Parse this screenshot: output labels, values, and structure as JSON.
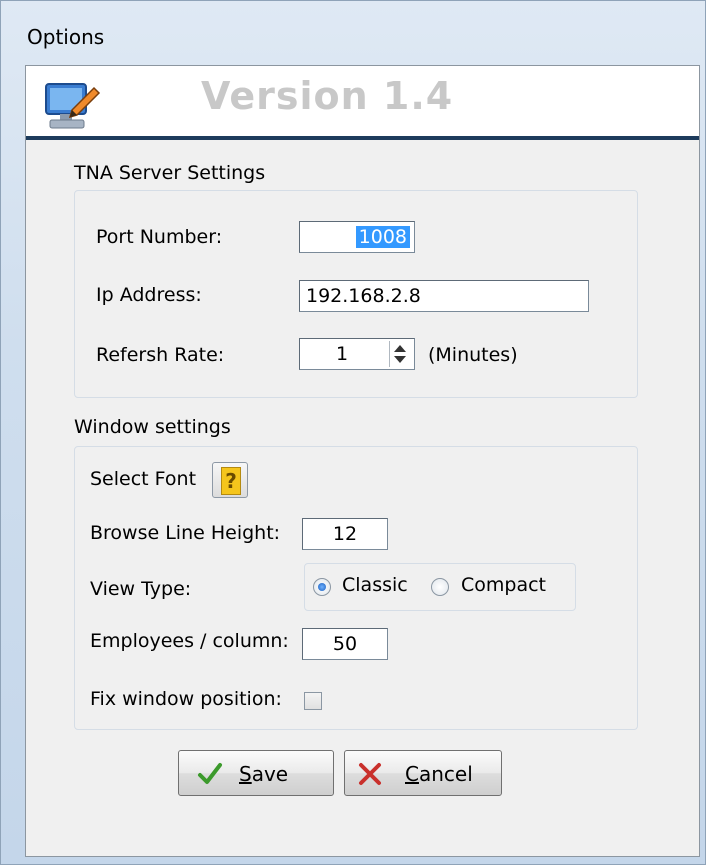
{
  "window": {
    "title": "Options"
  },
  "banner": {
    "version": "Version 1.4"
  },
  "tna": {
    "group_label": "TNA Server Settings",
    "port_label": "Port Number:",
    "port_value": "1008",
    "ip_label": "Ip Address:",
    "ip_value": "192.168.2.8",
    "refresh_label": "Refersh Rate:",
    "refresh_value": "1",
    "refresh_unit": "(Minutes)"
  },
  "window_settings": {
    "group_label": "Window settings",
    "font_label": "Select Font",
    "help_glyph": "?",
    "line_height_label": "Browse Line Height:",
    "line_height_value": "12",
    "view_type_label": "View Type:",
    "view_options": [
      {
        "label": "Classic",
        "selected": true
      },
      {
        "label": "Compact",
        "selected": false
      }
    ],
    "employees_label": "Employees / column:",
    "employees_value": "50",
    "fix_label": "Fix window position:",
    "fix_checked": false
  },
  "buttons": {
    "save_first": "S",
    "save_rest": "ave",
    "cancel_first": "C",
    "cancel_rest": "ancel"
  },
  "icons": {
    "app": "monitor-pencil-icon",
    "help": "question-mark-icon",
    "save": "checkmark-icon",
    "cancel": "x-mark-icon"
  },
  "colors": {
    "banner_line": "#1d3b5c",
    "selection": "#3399ff",
    "save_check": "#3c9a2c",
    "cancel_x": "#c9302c"
  }
}
